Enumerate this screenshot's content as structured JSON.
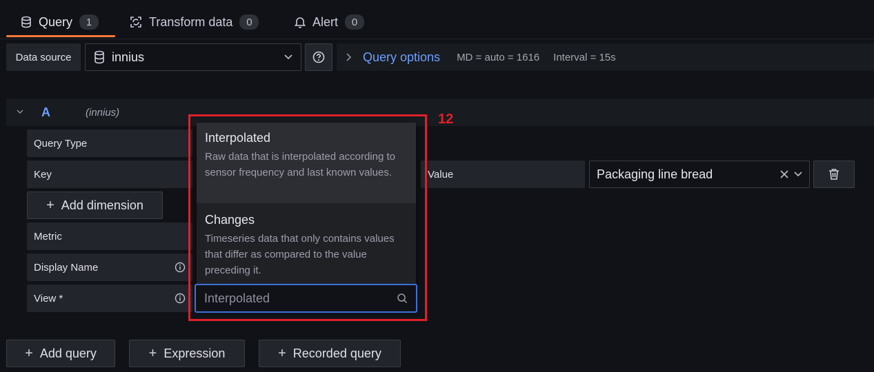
{
  "tabs": [
    {
      "label": "Query",
      "count": "1",
      "icon": "database-icon"
    },
    {
      "label": "Transform data",
      "count": "0",
      "icon": "transform-icon"
    },
    {
      "label": "Alert",
      "count": "0",
      "icon": "bell-icon"
    }
  ],
  "datasource": {
    "label": "Data source",
    "selected": "innius"
  },
  "query_options": {
    "title": "Query options",
    "md": "MD = auto = 1616",
    "interval": "Interval = 15s"
  },
  "query": {
    "letter": "A",
    "datasource_name": "(innius)"
  },
  "fields": {
    "query_type": "Query Type",
    "key": "Key",
    "value": "Value",
    "value_selected": "Packaging line bread",
    "metric": "Metric",
    "display_name": "Display Name",
    "view": "View *",
    "view_placeholder": "Interpolated"
  },
  "buttons": {
    "add_dimension": "Add dimension",
    "add_query": "Add query",
    "expression": "Expression",
    "recorded_query": "Recorded query"
  },
  "menu": {
    "items": [
      {
        "title": "Interpolated",
        "description": "Raw data that is interpolated according to sensor frequency and last known values."
      },
      {
        "title": "Changes",
        "description": "Timeseries data that only contains values that differ as compared to the value preceding it."
      }
    ]
  },
  "annotation": {
    "marker": "12",
    "color": "#e0202a"
  },
  "colors": {
    "accent": "#ff7a39",
    "link": "#6e9fff",
    "focus": "#3d71d9"
  }
}
